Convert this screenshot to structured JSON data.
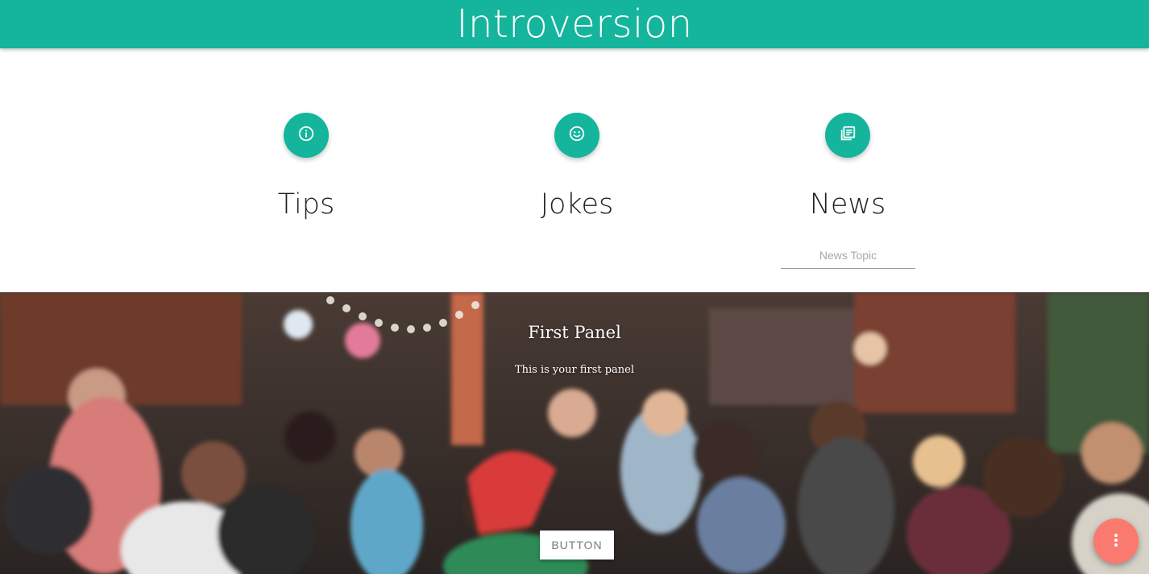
{
  "header": {
    "title": "Introversion"
  },
  "features": [
    {
      "label": "Tips",
      "icon": "info-icon"
    },
    {
      "label": "Jokes",
      "icon": "smiley-icon"
    },
    {
      "label": "News",
      "icon": "newspaper-icon"
    }
  ],
  "news": {
    "placeholder": "News Topic",
    "value": ""
  },
  "panel": {
    "title": "First Panel",
    "subtitle": "This is your first panel",
    "button_label": "BUTTON",
    "background": "crowd-photo"
  },
  "fab": {
    "icon": "more-vert-icon"
  },
  "colors": {
    "accent": "#14b59c",
    "fab": "#fa7a6f",
    "text": "#222222"
  }
}
